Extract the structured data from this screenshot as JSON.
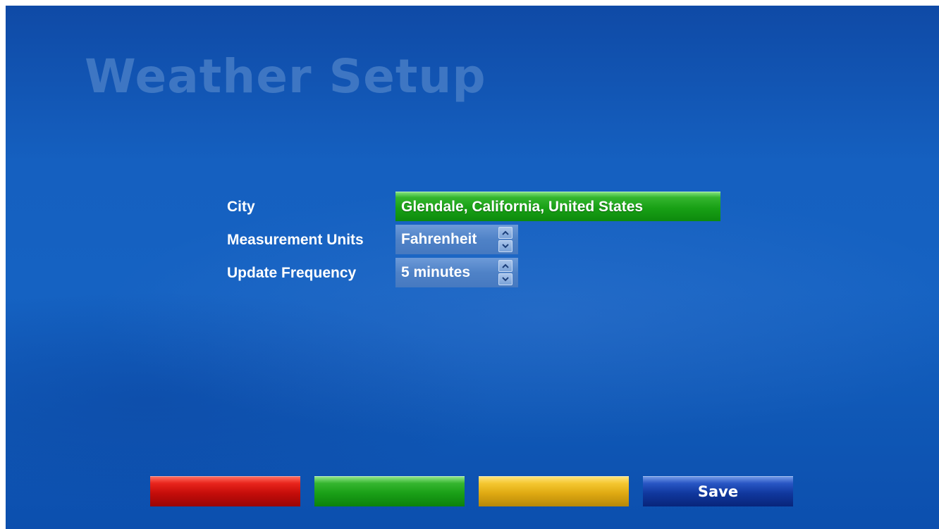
{
  "title": "Weather Setup",
  "settings": {
    "city": {
      "label": "City",
      "value": "Glendale, California, United States"
    },
    "units": {
      "label": "Measurement Units",
      "value": "Fahrenheit"
    },
    "frequency": {
      "label": "Update Frequency",
      "value": "5 minutes"
    }
  },
  "buttons": {
    "red": {
      "label": "",
      "color": "#c50d0a"
    },
    "green": {
      "label": "",
      "color": "#1aa017"
    },
    "yellow": {
      "label": "",
      "color": "#e0aa12"
    },
    "blue": {
      "label": "Save",
      "color": "#10389e"
    }
  },
  "icons": {
    "spin_up": "chevron-up-icon",
    "spin_down": "chevron-down-icon"
  }
}
